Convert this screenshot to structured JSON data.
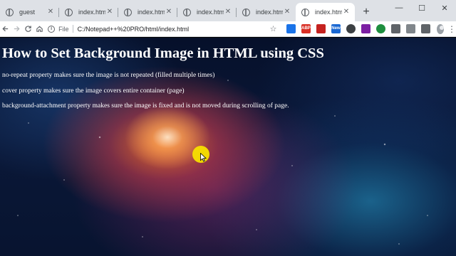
{
  "browser": {
    "tabs": [
      {
        "label": "guest",
        "active": false
      },
      {
        "label": "index.html",
        "active": false
      },
      {
        "label": "index.html",
        "active": false
      },
      {
        "label": "index.html",
        "active": false
      },
      {
        "label": "index.html",
        "active": false
      },
      {
        "label": "index.html",
        "active": true
      }
    ],
    "new_tab_symbol": "+",
    "window_controls": {
      "minimize": "—",
      "maximize": "☐",
      "close": "✕"
    },
    "address": {
      "scheme": "File",
      "url": "C:/Notepad++%20PRO/html/index.html"
    },
    "extension_icons": [
      "screen-capture-icon",
      "adblock-icon",
      "extension-icon",
      "new-badge-icon",
      "ghost-icon",
      "docs-icon",
      "color-picker-icon",
      "translate-icon",
      "recorder-icon",
      "puzzle-icon"
    ],
    "extension_labels": {
      "adblock": "ABP",
      "new_badge": "New"
    }
  },
  "page": {
    "heading": "How to Set Background Image in HTML using CSS",
    "paragraphs": [
      "no-repeat property makes sure the image is not repeated (filled multiple times)",
      "cover property makes sure the image covers entire container (page)",
      "background-attachment property makes sure the image is fixed and is not moved during scrolling of page."
    ]
  },
  "colors": {
    "tabstrip": "#dee1e6",
    "toolbar": "#ffffff",
    "text_on_page": "#ffffff",
    "cursor_highlight": "#f7e000"
  }
}
